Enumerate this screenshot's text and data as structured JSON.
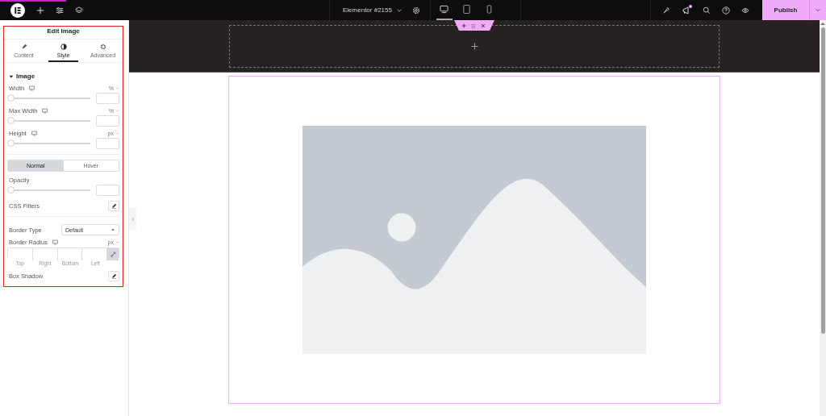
{
  "topbar": {
    "document_title": "Elementor #2155",
    "devices": [
      {
        "kind": "desktop",
        "selected": true
      },
      {
        "kind": "tablet",
        "selected": false
      },
      {
        "kind": "mobile",
        "selected": false
      }
    ],
    "notification": true,
    "publish": "Publish"
  },
  "panel": {
    "title": "Edit Image",
    "tabs": [
      {
        "label": "Content",
        "selected": false
      },
      {
        "label": "Style",
        "selected": true
      },
      {
        "label": "Advanced",
        "selected": false
      }
    ],
    "section": {
      "title": "Image",
      "expanded": true,
      "controls": [
        {
          "kind": "slider",
          "label": "Width",
          "responsive": true,
          "unit": "%",
          "level": 0
        },
        {
          "kind": "slider",
          "label": "Max Width",
          "responsive": true,
          "unit": "%",
          "level": 0
        },
        {
          "kind": "slider",
          "label": "Height",
          "responsive": true,
          "unit": "px",
          "level": 0
        },
        {
          "kind": "divider"
        },
        {
          "kind": "toggle",
          "options": [
            {
              "label": "Normal",
              "selected": true
            },
            {
              "label": "Hover",
              "selected": false
            }
          ]
        },
        {
          "kind": "slider",
          "label": "Opacity",
          "responsive": false,
          "level": 0
        },
        {
          "kind": "popover",
          "label": "CSS Filters"
        },
        {
          "kind": "divider"
        },
        {
          "kind": "select",
          "label": "Border Type",
          "value": "Default"
        },
        {
          "kind": "dimensions",
          "label": "Border Radius",
          "responsive": true,
          "unit": "px",
          "sides": [
            "Top",
            "Right",
            "Bottom",
            "Left"
          ],
          "linked": true
        },
        {
          "kind": "popover",
          "label": "Box Shadow"
        }
      ]
    }
  },
  "canvas": {
    "empty_section_selected": true
  }
}
